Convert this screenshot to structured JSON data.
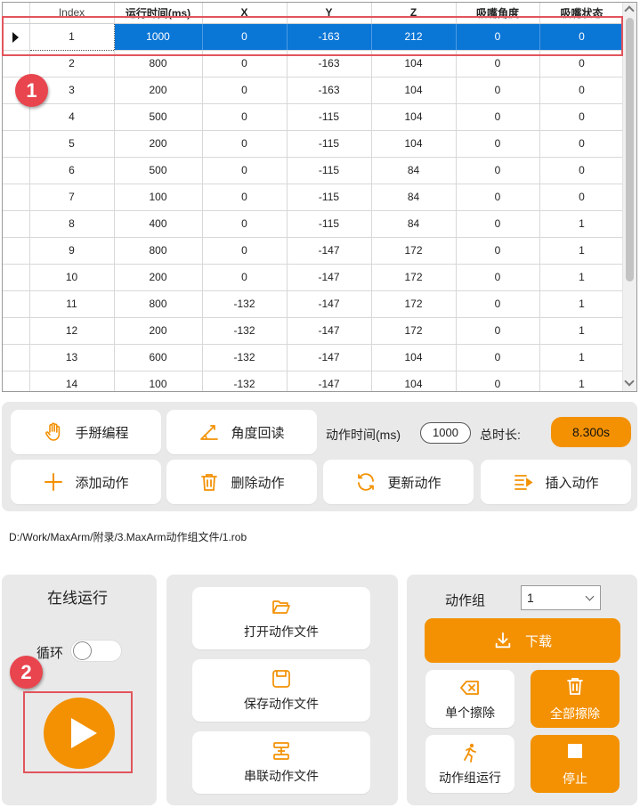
{
  "table": {
    "columns": [
      "Index",
      "运行时间(ms)",
      "X",
      "Y",
      "Z",
      "吸嘴角度",
      "吸嘴状态"
    ],
    "selected_row": 0,
    "rows": [
      [
        "1",
        "1000",
        "0",
        "-163",
        "212",
        "0",
        "0"
      ],
      [
        "2",
        "800",
        "0",
        "-163",
        "104",
        "0",
        "0"
      ],
      [
        "3",
        "200",
        "0",
        "-163",
        "104",
        "0",
        "0"
      ],
      [
        "4",
        "500",
        "0",
        "-115",
        "104",
        "0",
        "0"
      ],
      [
        "5",
        "200",
        "0",
        "-115",
        "104",
        "0",
        "0"
      ],
      [
        "6",
        "500",
        "0",
        "-115",
        "84",
        "0",
        "0"
      ],
      [
        "7",
        "100",
        "0",
        "-115",
        "84",
        "0",
        "0"
      ],
      [
        "8",
        "400",
        "0",
        "-115",
        "84",
        "0",
        "1"
      ],
      [
        "9",
        "800",
        "0",
        "-147",
        "172",
        "0",
        "1"
      ],
      [
        "10",
        "200",
        "0",
        "-147",
        "172",
        "0",
        "1"
      ],
      [
        "11",
        "800",
        "-132",
        "-147",
        "172",
        "0",
        "1"
      ],
      [
        "12",
        "200",
        "-132",
        "-147",
        "172",
        "0",
        "1"
      ],
      [
        "13",
        "600",
        "-132",
        "-147",
        "104",
        "0",
        "1"
      ],
      [
        "14",
        "100",
        "-132",
        "-147",
        "104",
        "0",
        "1"
      ]
    ]
  },
  "callouts": {
    "one": "1",
    "two": "2"
  },
  "controls": {
    "manual_programming": "手掰编程",
    "angle_readback": "角度回读",
    "action_time_label": "动作时间(ms)",
    "action_time_value": "1000",
    "total_time_label": "总时长:",
    "total_time_value": "8.300s",
    "add_action": "添加动作",
    "delete_action": "删除动作",
    "update_action": "更新动作",
    "insert_action": "插入动作"
  },
  "file_path": "D:/Work/MaxArm/附录/3.MaxArm动作组文件/1.rob",
  "online": {
    "title": "在线运行",
    "loop_label": "循环",
    "loop_on": false
  },
  "files": {
    "open": "打开动作文件",
    "save": "保存动作文件",
    "chain": "串联动作文件"
  },
  "group": {
    "label": "动作组",
    "selected": "1",
    "download": "下载",
    "erase_single": "单个擦除",
    "erase_all": "全部擦除",
    "run_group": "动作组运行",
    "stop": "停止"
  },
  "colors": {
    "accent": "#f39103",
    "selection": "#0a76d6",
    "callout": "#e8454e"
  }
}
